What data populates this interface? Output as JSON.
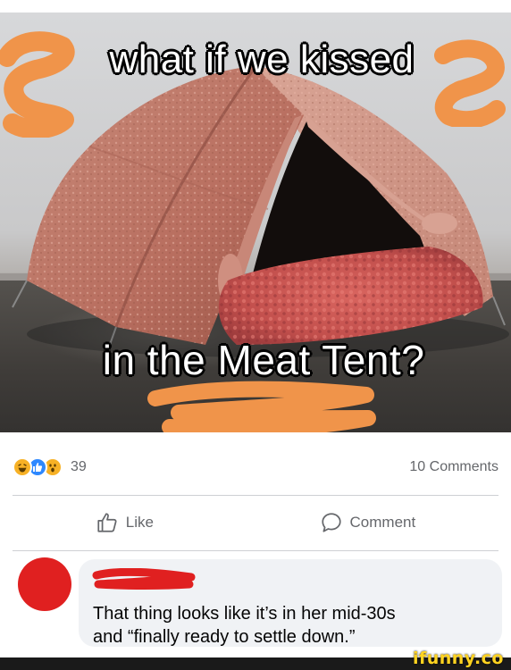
{
  "meme": {
    "top_caption": "what if we kissed",
    "bottom_caption": "in the Meat Tent?"
  },
  "reactions": {
    "icons": [
      "haha-icon",
      "like-icon",
      "wow-icon"
    ],
    "count": "39",
    "comments_count": "10 Comments"
  },
  "actions": {
    "like_label": "Like",
    "comment_label": "Comment"
  },
  "comment": {
    "text_line1": "That thing looks like it’s in her mid-30s",
    "text_line2": "and “finally ready to settle down.”"
  },
  "watermark": "ifunny.co",
  "colors": {
    "redaction_orange": "#f0944a",
    "redaction_red": "#e02020",
    "like_blue": "#2d88ff",
    "reaction_yellow": "#f7b125",
    "watermark_yellow": "#ffd320"
  }
}
